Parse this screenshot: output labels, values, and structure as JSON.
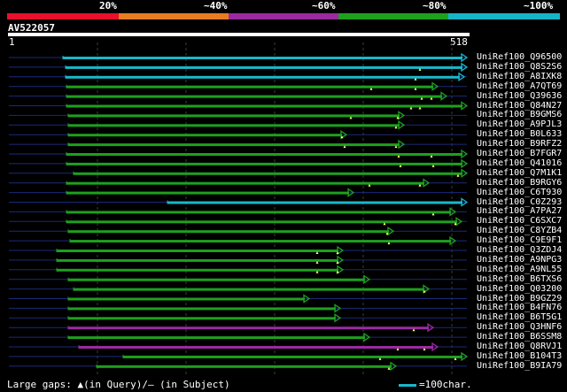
{
  "legend": {
    "labels": [
      "20%",
      "~40%",
      "~60%",
      "~80%",
      "~100%"
    ],
    "colors": [
      "#e8102c",
      "#e87c20",
      "#9a2aa0",
      "#1ea01e",
      "#16b4c8"
    ]
  },
  "query": {
    "id": "AV522057",
    "start_label": "1",
    "end_label": "518",
    "length": 518
  },
  "hits": [
    {
      "id": "UniRef100_Q96500",
      "start": 62,
      "end": 518,
      "color": "cyan",
      "gaps": []
    },
    {
      "id": "UniRef100_Q8S2S6",
      "start": 65,
      "end": 518,
      "color": "cyan",
      "gaps": [
        465
      ]
    },
    {
      "id": "UniRef100_A8IXK8",
      "start": 65,
      "end": 515,
      "color": "cyan",
      "gaps": [
        460
      ]
    },
    {
      "id": "UniRef100_A7QT69",
      "start": 66,
      "end": 485,
      "color": "green",
      "gaps": [
        410,
        460
      ]
    },
    {
      "id": "UniRef100_Q39636",
      "start": 66,
      "end": 495,
      "color": "green",
      "gaps": [
        467,
        478
      ]
    },
    {
      "id": "UniRef100_Q84N27",
      "start": 66,
      "end": 518,
      "color": "green",
      "gaps": [
        455,
        465
      ]
    },
    {
      "id": "UniRef100_B9GMS6",
      "start": 68,
      "end": 447,
      "color": "green",
      "gaps": [
        387,
        440
      ]
    },
    {
      "id": "UniRef100_A9PJL3",
      "start": 68,
      "end": 447,
      "color": "green",
      "gaps": [
        438
      ]
    },
    {
      "id": "UniRef100_B0L633",
      "start": 68,
      "end": 382,
      "color": "green",
      "gaps": [
        377
      ]
    },
    {
      "id": "UniRef100_B9RFZ2",
      "start": 68,
      "end": 447,
      "color": "green",
      "gaps": [
        380,
        438
      ]
    },
    {
      "id": "UniRef100_B7FGR7",
      "start": 66,
      "end": 518,
      "color": "green",
      "gaps": [
        441,
        478
      ]
    },
    {
      "id": "UniRef100_Q41016",
      "start": 66,
      "end": 518,
      "color": "green",
      "gaps": [
        443,
        480
      ]
    },
    {
      "id": "UniRef100_Q7M1K1",
      "start": 74,
      "end": 518,
      "color": "green",
      "gaps": [
        508
      ]
    },
    {
      "id": "UniRef100_B9RGY6",
      "start": 66,
      "end": 475,
      "color": "green",
      "gaps": [
        408,
        465
      ]
    },
    {
      "id": "UniRef100_C6T930",
      "start": 66,
      "end": 390,
      "color": "green",
      "gaps": []
    },
    {
      "id": "UniRef100_C0Z293",
      "start": 180,
      "end": 518,
      "color": "cyan",
      "gaps": []
    },
    {
      "id": "UniRef100_A7PA27",
      "start": 66,
      "end": 505,
      "color": "green",
      "gaps": [
        480
      ]
    },
    {
      "id": "UniRef100_C6SXC7",
      "start": 66,
      "end": 512,
      "color": "green",
      "gaps": [
        425,
        505
      ]
    },
    {
      "id": "UniRef100_C8YZB4",
      "start": 68,
      "end": 435,
      "color": "green",
      "gaps": [
        428
      ]
    },
    {
      "id": "UniRef100_C9E9F1",
      "start": 70,
      "end": 505,
      "color": "green",
      "gaps": [
        430
      ]
    },
    {
      "id": "UniRef100_Q3ZDJ4",
      "start": 55,
      "end": 378,
      "color": "green",
      "gaps": [
        349,
        372
      ]
    },
    {
      "id": "UniRef100_A9NPG3",
      "start": 55,
      "end": 378,
      "color": "green",
      "gaps": [
        349,
        372
      ]
    },
    {
      "id": "UniRef100_A9NL55",
      "start": 55,
      "end": 378,
      "color": "green",
      "gaps": [
        349,
        372
      ]
    },
    {
      "id": "UniRef100_B6TXS6",
      "start": 68,
      "end": 408,
      "color": "green",
      "gaps": []
    },
    {
      "id": "UniRef100_Q03200",
      "start": 74,
      "end": 475,
      "color": "green",
      "gaps": [
        470
      ]
    },
    {
      "id": "UniRef100_B9GZ29",
      "start": 68,
      "end": 340,
      "color": "green",
      "gaps": []
    },
    {
      "id": "UniRef100_B4FN76",
      "start": 68,
      "end": 375,
      "color": "green",
      "gaps": []
    },
    {
      "id": "UniRef100_B6T5G1",
      "start": 68,
      "end": 375,
      "color": "green",
      "gaps": []
    },
    {
      "id": "UniRef100_Q3HNF6",
      "start": 68,
      "end": 480,
      "color": "purple",
      "gaps": [
        458
      ]
    },
    {
      "id": "UniRef100_B6SSM8",
      "start": 68,
      "end": 408,
      "color": "green",
      "gaps": []
    },
    {
      "id": "UniRef100_Q8RVJ1",
      "start": 80,
      "end": 485,
      "color": "purple",
      "gaps": [
        440,
        470
      ]
    },
    {
      "id": "UniRef100_B104T3",
      "start": 130,
      "end": 518,
      "color": "green",
      "gaps": [
        420,
        505
      ]
    },
    {
      "id": "UniRef100_B9IA79",
      "start": 100,
      "end": 438,
      "color": "green",
      "gaps": [
        430
      ]
    }
  ],
  "footer": {
    "gaps_text": "Large gaps: ▲(in Query)/– (in Subject)",
    "scale_text": "=100char."
  },
  "colors": {
    "cyan": "#18b8cc",
    "green": "#1ea01e",
    "purple": "#9a2aa0",
    "query_bar": "#ffffff",
    "grid": "#3c3c3c",
    "dim_line": "#1a2a7a",
    "gap_marker": "#ffff66"
  }
}
